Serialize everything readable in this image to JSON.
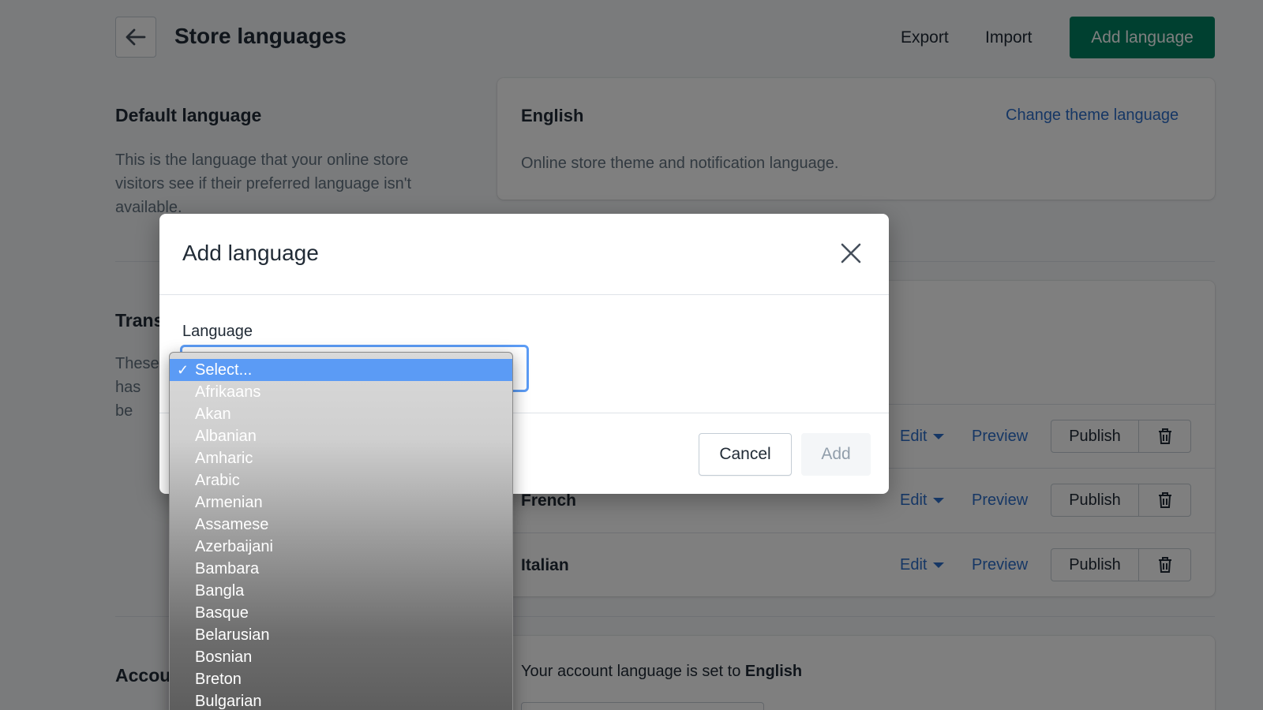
{
  "header": {
    "title": "Store languages",
    "export_label": "Export",
    "import_label": "Import",
    "add_language_label": "Add language"
  },
  "default_language": {
    "section_title": "Default language",
    "description": "This is the language that your online store visitors see if their preferred language isn't available.",
    "card_language": "English",
    "change_link": "Change theme language",
    "card_text": "Online store theme and notification language."
  },
  "translated": {
    "section_title": "Trans",
    "description": "These has be",
    "rows": [
      {
        "name": "",
        "edit": "Edit",
        "preview": "Preview",
        "publish": "Publish"
      },
      {
        "name": "French",
        "edit": "Edit",
        "preview": "Preview",
        "publish": "Publish"
      },
      {
        "name": "Italian",
        "edit": "Edit",
        "preview": "Preview",
        "publish": "Publish"
      }
    ]
  },
  "account": {
    "section_title": "Accou",
    "text_prefix": "Your account language is set to ",
    "text_value": "English"
  },
  "modal": {
    "title": "Add language",
    "field_label": "Language",
    "cancel_label": "Cancel",
    "add_label": "Add"
  },
  "dropdown": {
    "check": "✓",
    "options": [
      "Select...",
      "Afrikaans",
      "Akan",
      "Albanian",
      "Amharic",
      "Arabic",
      "Armenian",
      "Assamese",
      "Azerbaijani",
      "Bambara",
      "Bangla",
      "Basque",
      "Belarusian",
      "Bosnian",
      "Breton",
      "Bulgarian"
    ],
    "selected_index": 0
  },
  "colors": {
    "primary": "#008060",
    "link": "#2c6ecb",
    "dropdown_highlight": "#5b9bf5",
    "focus_ring": "#5c9cf5"
  }
}
